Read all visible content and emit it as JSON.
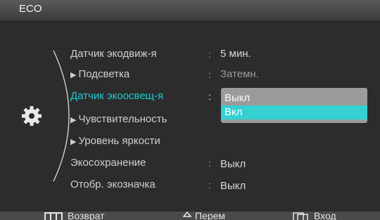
{
  "window": {
    "title": "ECO"
  },
  "menu": {
    "items": [
      {
        "label": "Датчик экодвиж-я",
        "has_arrow": false,
        "value": "5 мин.",
        "value_dim": false,
        "active": false
      },
      {
        "label": "Подсветка",
        "has_arrow": true,
        "value": "Затемн.",
        "value_dim": true,
        "active": false
      },
      {
        "label": "Датчик экоосвещ-я",
        "has_arrow": false,
        "value": "",
        "value_dim": false,
        "active": true
      },
      {
        "label": "Чувствительность",
        "has_arrow": true,
        "value": "",
        "value_dim": false,
        "active": false
      },
      {
        "label": "Уровень яркости",
        "has_arrow": true,
        "value": "",
        "value_dim": false,
        "active": false
      },
      {
        "label": "Экосохранение",
        "has_arrow": false,
        "value": "Выкл",
        "value_dim": false,
        "active": false
      },
      {
        "label": "Отобр. экозначка",
        "has_arrow": false,
        "value": "Выкл",
        "value_dim": false,
        "active": false
      }
    ],
    "separator": ":",
    "arrow_glyph": "▶"
  },
  "dropdown": {
    "options": [
      "Выкл",
      "Вкл"
    ],
    "selected_index": 1
  },
  "footer": {
    "back_label": "Возврат",
    "move_label": "Перем",
    "enter_label": "Вход"
  },
  "icons": {
    "category": "gear-icon",
    "back": "menu-bars-icon",
    "move": "up-down-diamond-icon",
    "enter": "enter-icon"
  },
  "colors": {
    "accent": "#1fc9cf",
    "selected_option_bg": "#35d0d2",
    "dropdown_bg": "#9b9b9b",
    "panel_bg": "#2c2c2c"
  }
}
